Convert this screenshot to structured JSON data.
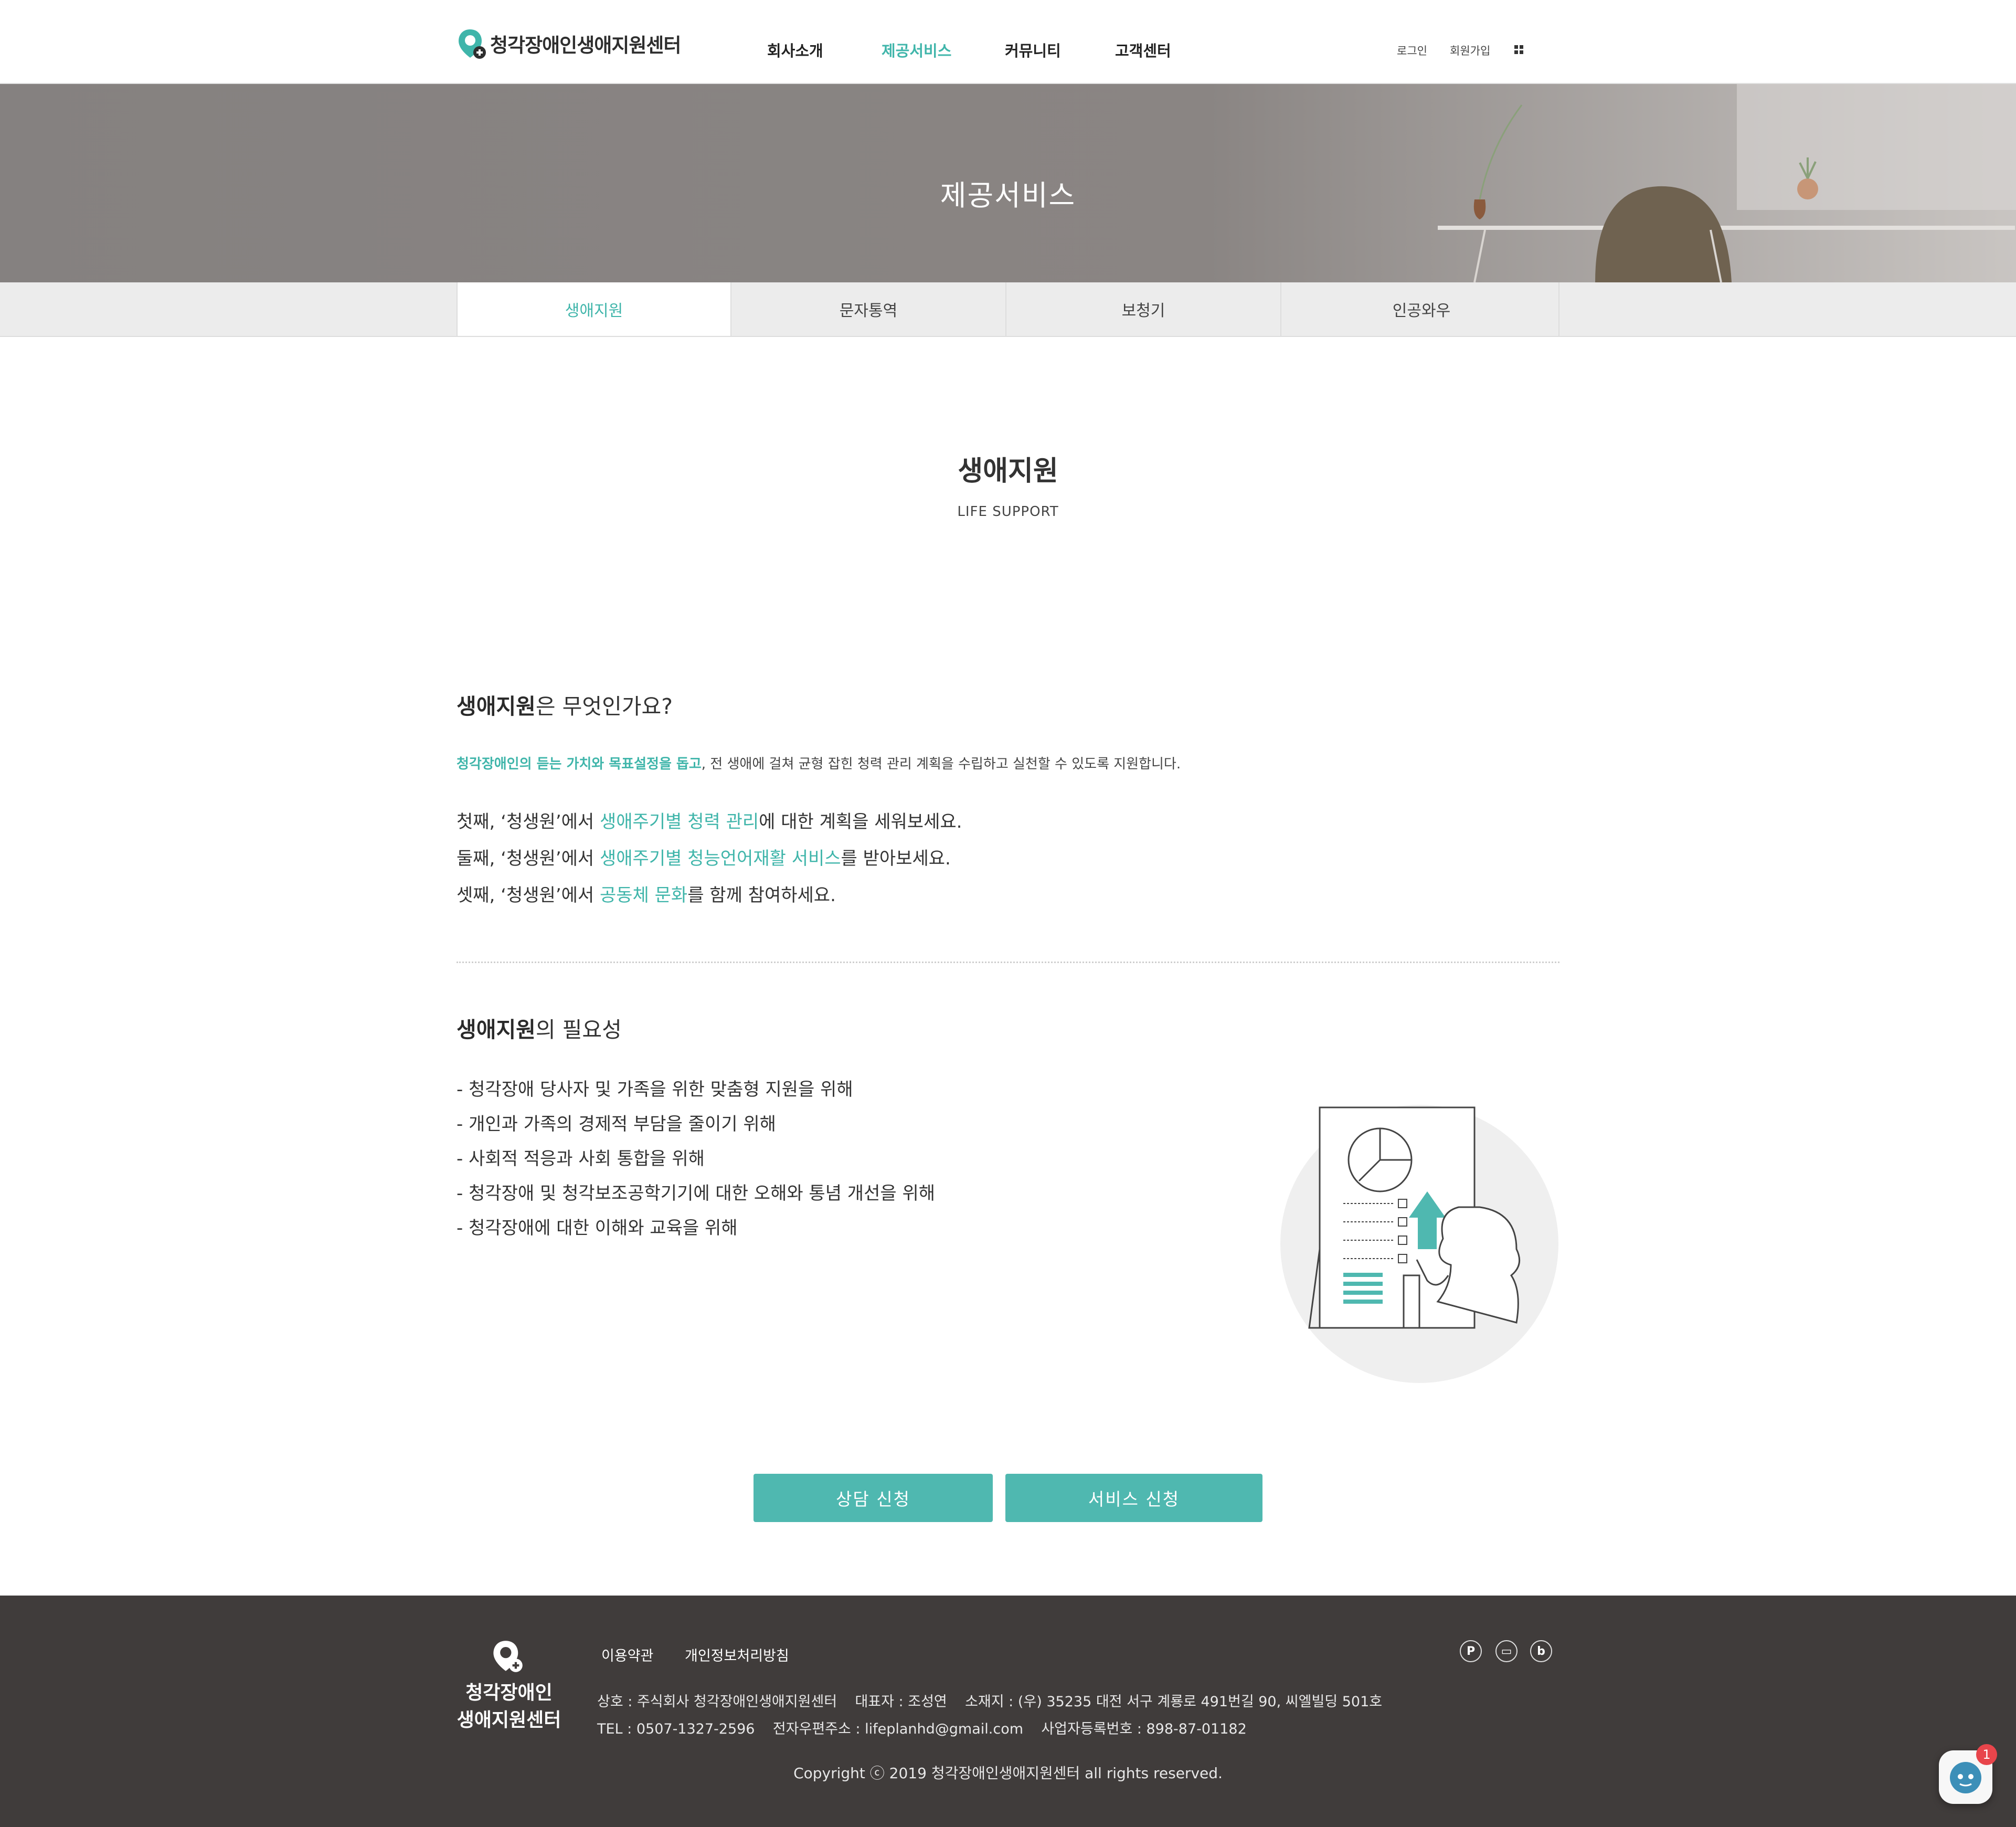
{
  "header": {
    "logo_text": "청각장애인생애지원센터",
    "nav": [
      "회사소개",
      "제공서비스",
      "커뮤니티",
      "고객센터"
    ],
    "active_nav": "제공서비스",
    "util": {
      "login": "로그인",
      "join": "회원가입"
    }
  },
  "hero": {
    "title": "제공서비스"
  },
  "subtabs": [
    "생애지원",
    "문자통역",
    "보청기",
    "인공와우"
  ],
  "section": {
    "title": "생애지원",
    "subtitle": "LIFE SUPPORT"
  },
  "what": {
    "title_bold": "생애지원",
    "title_rest": "은 무엇인가요?",
    "intro_highlight": "청각장애인의 듣는 가치와 목표설정을 돕고",
    "intro_rest": ", 전 생애에 걸쳐 균형 잡힌 청력 관리 계획을 수립하고 실천할 수 있도록 지원합니다.",
    "lines": [
      {
        "pre": "첫째, ‘청생원’에서 ",
        "hl": "생애주기별 청력 관리",
        "post": "에 대한 계획을 세워보세요."
      },
      {
        "pre": "둘째, ‘청생원’에서 ",
        "hl": "생애주기별 청능언어재활 서비스",
        "post": "를 받아보세요."
      },
      {
        "pre": "셋째, ‘청생원’에서 ",
        "hl": "공동체 문화",
        "post": "를 함께 참여하세요."
      }
    ]
  },
  "need": {
    "title_bold": "생애지원",
    "title_rest": "의 필요성",
    "items": [
      "- 청각장애 당사자 및 가족을 위한 맞춤형 지원을 위해",
      "- 개인과 가족의 경제적 부담을 줄이기 위해",
      "- 사회적 적응과 사회 통합을 위해",
      "- 청각장애 및 청각보조공학기기에 대한 오해와 통념 개선을 위해",
      "- 청각장애에 대한 이해와 교육을 위해"
    ]
  },
  "buttons": {
    "consult": "상담 신청",
    "service": "서비스 신청"
  },
  "footer": {
    "logo_line1": "청각장애인",
    "logo_line2": "생애지원센터",
    "links": [
      "이용약관",
      "개인정보처리방침"
    ],
    "info1": "상호 : 주식회사 청각장애인생애지원센터    대표자 : 조성연    소재지 : (우) 35235 대전 서구 계룡로 491번길 90, 씨엘빌딩 501호",
    "info2": "TEL : 0507-1327-2596    전자우편주소 : lifeplanhd@gmail.com    사업자등록번호 : 898-87-01182",
    "copyright": "Copyright ⓒ 2019 청각장애인생애지원센터 all rights reserved."
  },
  "chat": {
    "badge": "1"
  },
  "colors": {
    "accent": "#3fb5aa",
    "button": "#4fb8b0",
    "footer_bg": "#403c3b"
  }
}
